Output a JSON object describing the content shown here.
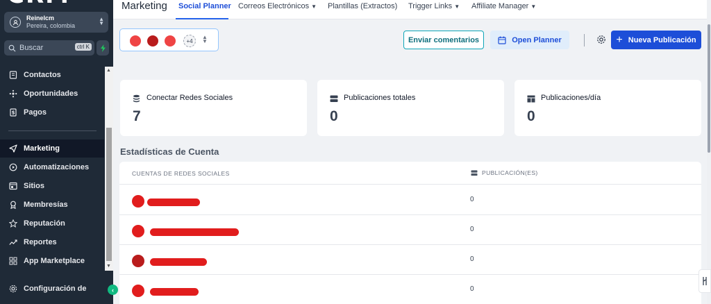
{
  "sidebar": {
    "location": {
      "name": "Reinelcm",
      "city": "Pereira, colombia"
    },
    "search": {
      "label": "Buscar",
      "shortcut": "ctrl K"
    },
    "items": [
      {
        "label": "Contactos",
        "icon": "contacts-icon"
      },
      {
        "label": "Oportunidades",
        "icon": "opportunities-icon"
      },
      {
        "label": "Pagos",
        "icon": "payments-icon"
      },
      {
        "label": "Marketing",
        "icon": "send-icon",
        "active": true
      },
      {
        "label": "Automatizaciones",
        "icon": "automation-icon"
      },
      {
        "label": "Sitios",
        "icon": "sites-icon"
      },
      {
        "label": "Membresías",
        "icon": "membership-icon"
      },
      {
        "label": "Reputación",
        "icon": "star-icon"
      },
      {
        "label": "Reportes",
        "icon": "reports-icon"
      },
      {
        "label": "App Marketplace",
        "icon": "apps-icon"
      }
    ],
    "settings": {
      "label": "Configuración de"
    }
  },
  "header": {
    "title": "Marketing",
    "tabs": [
      {
        "label": "Social Planner",
        "active": true
      },
      {
        "label": "Correos Electrónicos",
        "dropdown": true
      },
      {
        "label": "Plantillas (Extractos)",
        "dropdown": false
      },
      {
        "label": "Trigger Links",
        "dropdown": true
      },
      {
        "label": "Affiliate Manager",
        "dropdown": true
      }
    ]
  },
  "toolbar": {
    "account_more": "+4",
    "feedback_label": "Enviar comentarios",
    "planner_label": "Open Planner",
    "new_post_label": "Nueva Publicación"
  },
  "stats": [
    {
      "label": "Conectar Redes Sociales",
      "value": "7",
      "icon": "stack-icon"
    },
    {
      "label": "Publicaciones totales",
      "value": "0",
      "icon": "server-icon"
    },
    {
      "label": "Publicaciones/día",
      "value": "0",
      "icon": "layout-icon"
    }
  ],
  "section": {
    "title": "Estadísticas de Cuenta"
  },
  "table": {
    "headers": [
      "CUENTAS DE REDES SOCIALES",
      "PUBLICACIÓN(ES)"
    ],
    "rows": [
      {
        "count": "0"
      },
      {
        "count": "0"
      },
      {
        "count": "0"
      },
      {
        "count": "0"
      }
    ]
  },
  "colors": {
    "primary": "#1d4ed8",
    "sidebar": "#1f2a37",
    "redacted": "#e11d1d",
    "accent_green": "#10b981"
  }
}
